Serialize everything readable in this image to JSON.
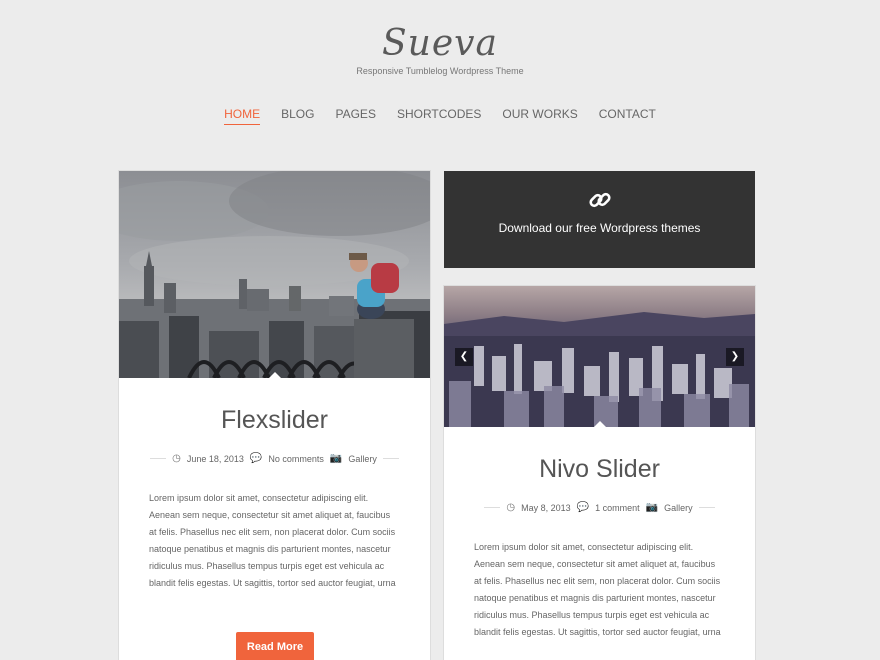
{
  "site": {
    "title": "Sueva",
    "tagline": "Responsive Tumblelog Wordpress Theme"
  },
  "nav": {
    "items": [
      "Home",
      "Blog",
      "Pages",
      "Shortcodes",
      "Our Works",
      "Contact"
    ],
    "active": "Home"
  },
  "posts": [
    {
      "title": "Flexslider",
      "date": "June 18, 2013",
      "comments": "No comments",
      "category": "Gallery",
      "excerpt": "Lorem ipsum dolor sit amet, consectetur adipiscing elit. Aenean sem neque, consectetur sit amet aliquet at, faucibus at felis. Phasellus nec elit sem, non placerat dolor. Cum sociis natoque penatibus et magnis dis parturient montes, nascetur ridiculus mus. Phasellus tempus turpis eget est vehicula ac blandit felis egestas. Ut sagittis, tortor sed auctor feugiat, urna",
      "read_more": "Read More"
    },
    {
      "title": "Nivo Slider",
      "date": "May 8, 2013",
      "comments": "1 comment",
      "category": "Gallery",
      "excerpt": "Lorem ipsum dolor sit amet, consectetur adipiscing elit. Aenean sem neque, consectetur sit amet aliquet at, faucibus at felis. Phasellus nec elit sem, non placerat dolor. Cum sociis natoque penatibus et magnis dis parturient montes, nascetur ridiculus mus. Phasellus tempus turpis eget est vehicula ac blandit felis egestas. Ut sagittis, tortor sed auctor feugiat, urna"
    }
  ],
  "download": {
    "text": "Download our free Wordpress themes",
    "icon": "link-icon"
  },
  "icons": {
    "date": "clock-icon",
    "comments": "comments-icon",
    "category": "camera-icon"
  },
  "colors": {
    "accent": "#f0643c",
    "dark_box": "#333333",
    "background": "#ececec"
  }
}
